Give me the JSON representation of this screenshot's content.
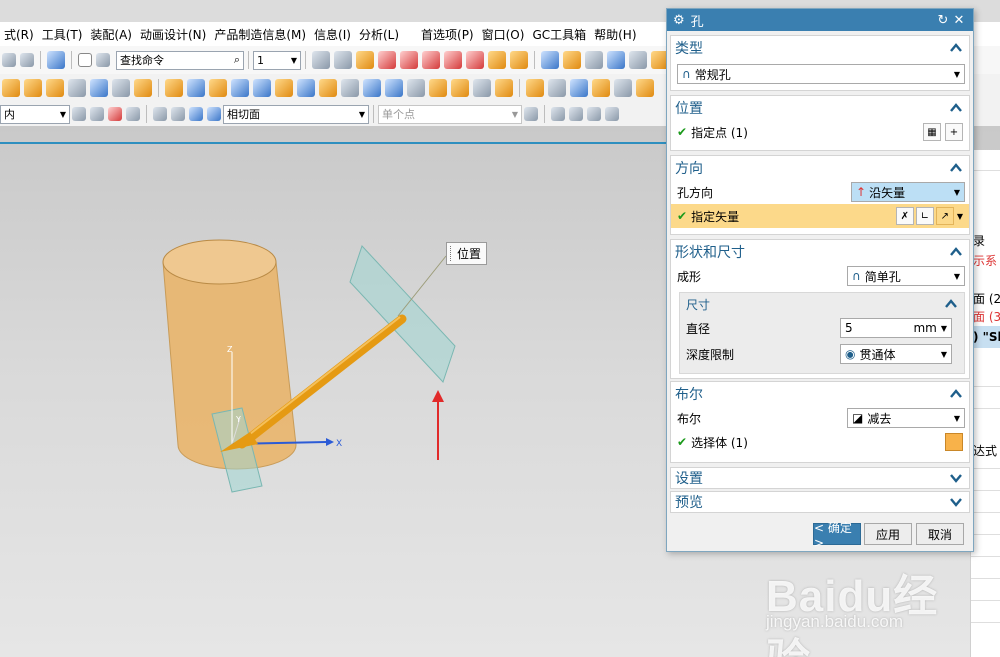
{
  "menu": [
    "式(R)",
    "工具(T)",
    "装配(A)",
    "动画设计(N)",
    "产品制造信息(M)",
    "信息(I)",
    "分析(L)",
    "首选项(P)",
    "窗口(O)",
    "GC工具箱",
    "帮助(H)"
  ],
  "toolbar": {
    "command_search": "查找命令",
    "scale_value": "1",
    "filter_value": "内",
    "snap_value": "相切面",
    "point_filter": "单个点"
  },
  "viewport": {
    "position_tip": "位置",
    "axis_x": "X",
    "axis_y": "Y",
    "axis_z": "Z"
  },
  "right_panel": {
    "rows": [
      "录",
      "示系",
      "面 (2)",
      "面 (3)",
      ") \"Sh",
      "达式"
    ]
  },
  "dialog": {
    "title": "孔",
    "title_icons": [
      "gear-icon",
      "reset-icon",
      "close-icon"
    ],
    "sections": {
      "type": {
        "header": "类型",
        "value": "常规孔"
      },
      "position": {
        "header": "位置",
        "label": "指定点 (1)"
      },
      "direction": {
        "header": "方向",
        "hole_dir_label": "孔方向",
        "hole_dir_value": "沿矢量",
        "vector_label": "指定矢量"
      },
      "shape": {
        "header": "形状和尺寸",
        "form_label": "成形",
        "form_value": "简单孔",
        "dims_header": "尺寸",
        "diameter_label": "直径",
        "diameter_value": "5",
        "diameter_unit": "mm",
        "depth_label": "深度限制",
        "depth_value": "贯通体"
      },
      "boolean": {
        "header": "布尔",
        "label": "布尔",
        "value": "减去",
        "select_label": "选择体 (1)"
      },
      "settings": {
        "header": "设置"
      },
      "preview": {
        "header": "预览"
      }
    },
    "buttons": {
      "ok": "< 确定 >",
      "apply": "应用",
      "cancel": "取消"
    }
  },
  "colors": {
    "dialog_title": "#3a7fb0",
    "section_header": "#1f5f8b",
    "highlight_row": "#fcd98a",
    "model_body": "#e8b56e",
    "vector_arrow": "#e59a13",
    "check": "#1b9a1b"
  },
  "watermark": {
    "brand": "Baidu经验",
    "url": "jingyan.baidu.com"
  }
}
